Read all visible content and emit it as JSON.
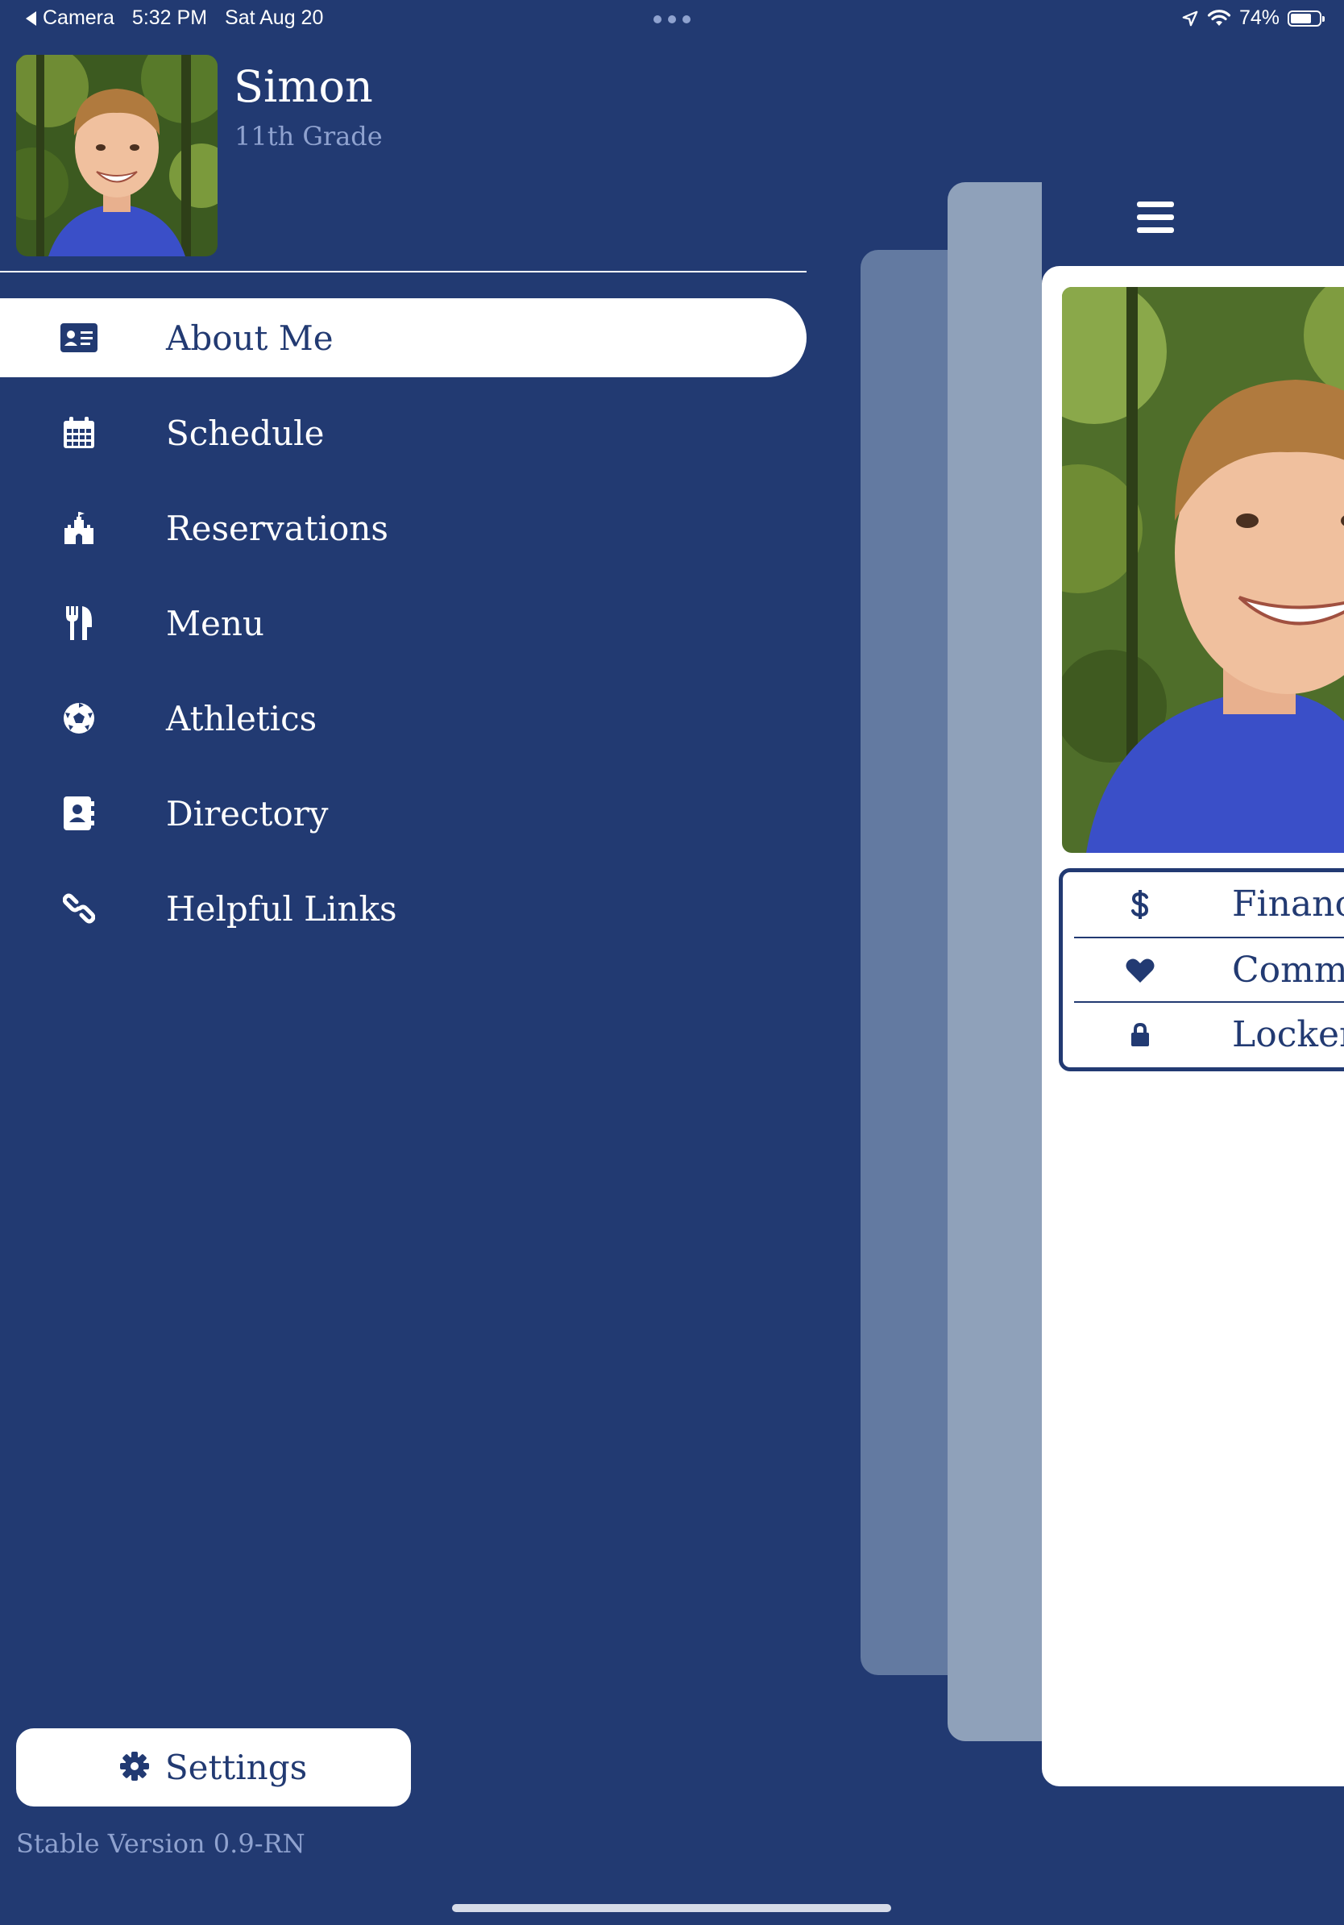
{
  "status_bar": {
    "back_label": "Camera",
    "time": "5:32 PM",
    "date": "Sat Aug 20",
    "battery": "74%",
    "battery_level": 0.74
  },
  "profile": {
    "name": "Simon",
    "grade": "11th Grade"
  },
  "nav": {
    "items": [
      {
        "label": "About Me",
        "icon": "id-card-icon"
      },
      {
        "label": "Schedule",
        "icon": "calendar-icon"
      },
      {
        "label": "Reservations",
        "icon": "castle-icon"
      },
      {
        "label": "Menu",
        "icon": "utensils-icon"
      },
      {
        "label": "Athletics",
        "icon": "soccer-ball-icon"
      },
      {
        "label": "Directory",
        "icon": "address-book-icon"
      },
      {
        "label": "Helpful Links",
        "icon": "link-icon"
      }
    ],
    "active_index": 0
  },
  "settings": {
    "label": "Settings",
    "version": "Stable Version 0.9-RN"
  },
  "preview": {
    "quick_links": [
      {
        "label": "Financial",
        "icon": "dollar-icon"
      },
      {
        "label": "Commu",
        "icon": "heart-icon"
      },
      {
        "label": "Locker C",
        "icon": "lock-icon"
      }
    ]
  },
  "colors": {
    "background": "#223a72",
    "text": "#ffffff",
    "muted_text": "#8fa2cf",
    "active_item_bg": "#ffffff"
  }
}
